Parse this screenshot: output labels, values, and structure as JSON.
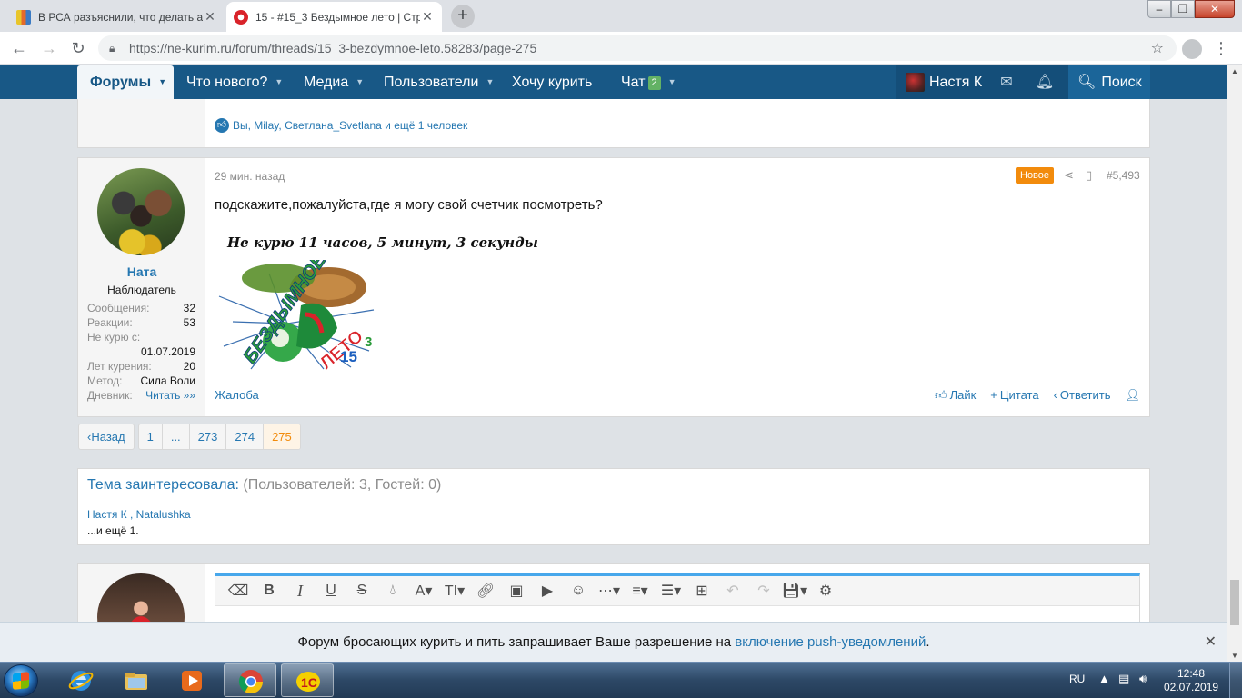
{
  "browser": {
    "tabs": [
      {
        "title": "В РСА разъяснили, что делать а",
        "close": "✕",
        "active": false
      },
      {
        "title": "15 - #15_3 Бездымное лето | Стр",
        "close": "✕",
        "active": true
      }
    ],
    "new_tab": "+",
    "url": "https://ne-kurim.ru/forum/threads/15_3-bezdymnoe-leto.58283/page-275"
  },
  "sitenav": {
    "forums": "Форумы",
    "whats_new": "Что нового?",
    "media": "Медиа",
    "users": "Пользователи",
    "want_smoke": "Хочу курить",
    "chat": "Чат",
    "chat_badge": "2",
    "account": "Настя К",
    "search": "Поиск"
  },
  "prev_post": {
    "reactions": "Вы, Milay, Светлана_Svetlana и ещё 1 человек"
  },
  "post": {
    "username": "Ната",
    "user_title": "Наблюдатель",
    "stats": [
      {
        "k": "Сообщения:",
        "v": "32"
      },
      {
        "k": "Реакции:",
        "v": "53"
      },
      {
        "k": "Не курю с:",
        "v": ""
      },
      {
        "k": "",
        "v": "01.07.2019"
      },
      {
        "k": "Лет курения:",
        "v": "20"
      },
      {
        "k": "Метод:",
        "v": "Сила Воли"
      },
      {
        "k": "Дневник:",
        "v": "Читать »»"
      }
    ],
    "time": "29 мин. назад",
    "new_badge": "Новое",
    "number": "#5,493",
    "body": "подскажите,пожалуйста,где я могу свой счетчик посмотреть?",
    "signature": "Не курю  11 часов, 5 минут, 3 секунды",
    "logo_text": "БЕЗДЫМНОЕ",
    "logo_text2": "ЛЕТО",
    "logo_num": "15",
    "logo_num2": "3",
    "report": "Жалоба",
    "like": "Лайк",
    "quote": "Цитата",
    "reply": "Ответить"
  },
  "pagination": {
    "prev": "Назад",
    "pages": [
      "1",
      "...",
      "273",
      "274",
      "275"
    ],
    "current": "275"
  },
  "interest": {
    "title_lead": "Тема заинтересовала:",
    "title_rest": " (Пользователей: 3, Гостей: 0)",
    "users": "Настя К , Natalushka",
    "more": "...и ещё 1."
  },
  "notice": {
    "text": "Форум бросающих курить и пить запрашивает Ваше разрешение на ",
    "link": "включение push-уведомлений",
    "end": "."
  },
  "taskbar": {
    "lang": "RU",
    "time": "12:48",
    "date": "02.07.2019"
  }
}
